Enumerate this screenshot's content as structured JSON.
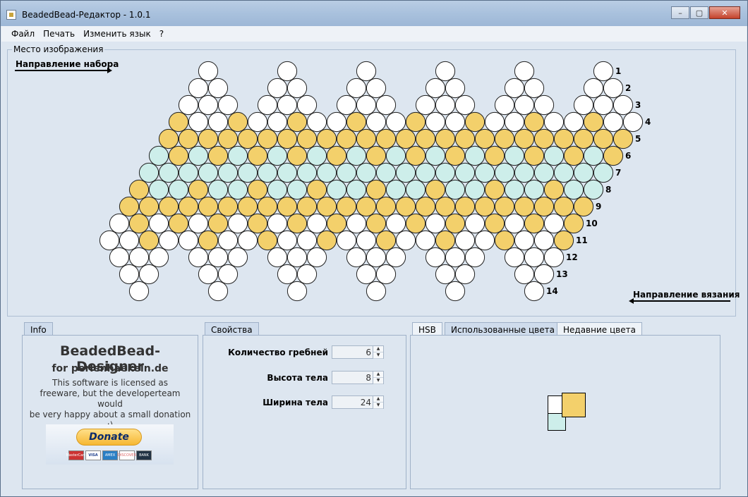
{
  "window": {
    "title": "BeadedBead-Редактор - 1.0.1",
    "controls": [
      "–",
      "▢",
      "✕"
    ]
  },
  "menu": [
    "Файл",
    "Печать",
    "Изменить язык",
    "?"
  ],
  "image_panel": {
    "title": "Место изображения",
    "dir_set": "Направление набора",
    "dir_knit": "Направление вязания",
    "row_numbers": [
      "1",
      "2",
      "3",
      "4",
      "5",
      "6",
      "7",
      "8",
      "9",
      "10",
      "11",
      "12",
      "13",
      "14"
    ]
  },
  "colors": {
    "white": "#ffffff",
    "yellow": "#f3d06b",
    "cyan": "#cdeeea"
  },
  "beads": {
    "column_count": 24,
    "rows": [
      "WWWWWWWWWWWWWWWWWWWWWWWW",
      "WWWWWWWWWWWWWWWWWWWWWWWW",
      "WWWWWWWWWWWWWWWWWWWWWWWW",
      "YWWYWWYWWYWWYWWYWWYWWYWW",
      "YYYYYYYYYYYYYYYYYYYYYYYY",
      "CYCYCYCYCYCYCYCYCYCYCYCY",
      "CCCCCCCCCCCCCCCCCCCCCCCC",
      "YCCYCCYCCYCCYCCYCCYCCYCC",
      "YYYYYYYYYYYYYYYYYYYYYYYY",
      "WYWYWYWYWYWYWYWYWYWYWYWY",
      "WWYWWYWWYWWYWWYWWYWWYWWY",
      "WWWWWWWWWWWWWWWWWWWWWWWW",
      "WWWWWWWWWWWWWWWWWWWWWWWW",
      "WWWWWWWWWWWWWWWWWWWWWWWW"
    ]
  },
  "info": {
    "tab": "Info",
    "title": "BeadedBead-Designer",
    "subtitle": "for perlenhaekeln.de",
    "text_lines": [
      "This software is licensed as",
      "freeware, but the developerteam would",
      "be very happy about a small donation :)"
    ],
    "donate": "Donate",
    "cards": [
      "MasterCard",
      "VISA",
      "AMEX",
      "DISCOVER",
      "BANK"
    ]
  },
  "properties": {
    "tab": "Свойства",
    "fields": [
      {
        "label": "Количество гребней",
        "value": "6"
      },
      {
        "label": "Высота тела",
        "value": "8"
      },
      {
        "label": "Ширина тела",
        "value": "24"
      }
    ]
  },
  "colors_panel": {
    "tabs": [
      "HSB",
      "Использованные цвета",
      "Недавние цвета"
    ]
  }
}
